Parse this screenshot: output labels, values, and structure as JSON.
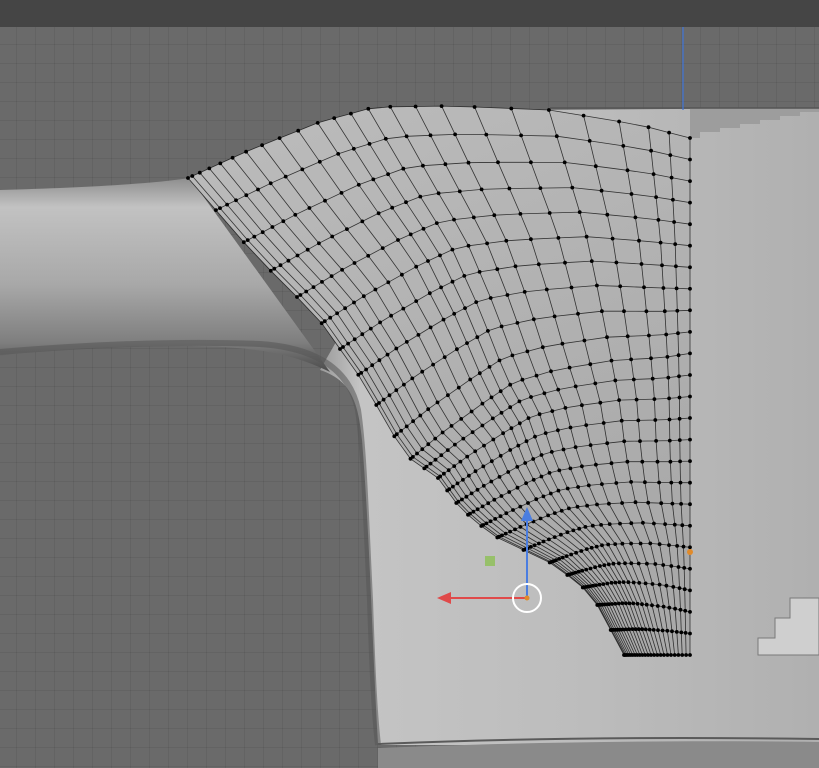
{
  "editor": {
    "mode": "edit",
    "object": "mesh",
    "selection": "vertex"
  },
  "colors": {
    "header": "#454545",
    "viewport_grid": "#6a6a6a",
    "mesh_surface": "#b9b9b9",
    "wireframe": "#111111",
    "gizmo_x": "#e04a4a",
    "gizmo_z": "#4a7de0",
    "gizmo_view_plane": "#8fbf5a",
    "active_vertex": "#e08a2a",
    "axis_line": "#3f74d8"
  },
  "icons": {
    "translate_gizmo": "move-gizmo-icon",
    "view_plane_handle": "square-handle-icon"
  }
}
